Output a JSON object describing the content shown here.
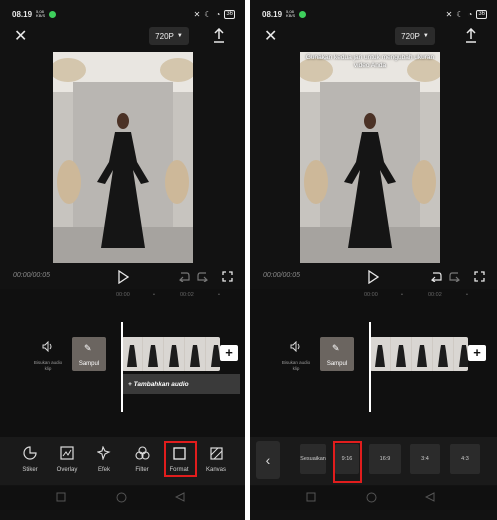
{
  "status": {
    "time": "08.19",
    "net_speed": "5,08 KB/S",
    "battery": "36"
  },
  "left": {
    "resolution": "720P",
    "timecode": "00:00/00:05",
    "ruler": [
      "00:00",
      "•",
      "00:02",
      "•"
    ],
    "mute_label": "Bisukan audio klip",
    "cover_label": "Sampul",
    "add_audio_label": "+ Tambahkan audio",
    "tools": [
      {
        "icon": "sticker-icon",
        "label": "Stiker"
      },
      {
        "icon": "overlay-icon",
        "label": "Overlay"
      },
      {
        "icon": "effect-icon",
        "label": "Efek"
      },
      {
        "icon": "filter-icon",
        "label": "Filter"
      },
      {
        "icon": "format-icon",
        "label": "Format"
      },
      {
        "icon": "canvas-icon",
        "label": "Kanvas"
      }
    ]
  },
  "right": {
    "resolution": "720P",
    "hint": "Gunakan kedua jari untuk mengubah ukuran video Anda",
    "timecode": "00:00/00:05",
    "ruler": [
      "00:00",
      "•",
      "00:02",
      "•"
    ],
    "mute_label": "Bisukan audio klip",
    "cover_label": "Sampul",
    "ratios": [
      "Sesuaikan",
      "9:16",
      "16:9",
      "3:4",
      "4:3"
    ]
  },
  "colors": {
    "highlight": "#e11d1d",
    "background": "#121212"
  }
}
